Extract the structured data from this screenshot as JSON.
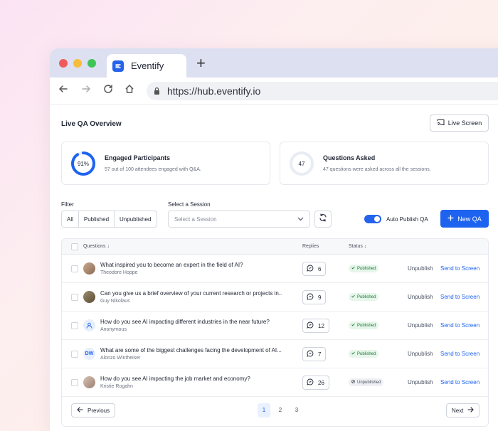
{
  "browser": {
    "tab_title": "Eventify",
    "new_tab": "+",
    "url": "https://hub.eventify.io"
  },
  "page": {
    "title": "Live QA Overview",
    "live_screen_label": "Live Screen"
  },
  "stats": [
    {
      "percent_label": "91%",
      "progress": 0.91,
      "title": "Engaged Participants",
      "subtitle": "57 out of 100 attendees engaged with Q&A."
    },
    {
      "percent_label": "47",
      "progress": 0.0,
      "title": "Questions Asked",
      "subtitle": "47 questions were asked across all the sessions."
    }
  ],
  "filters": {
    "filter_label": "Filter",
    "options": [
      "All",
      "Published",
      "Unpublished"
    ],
    "session_label": "Select a Session",
    "session_placeholder": "Select a Session",
    "auto_publish_label": "Auto Publish QA",
    "auto_publish_on": true,
    "new_qa_label": "New QA"
  },
  "table": {
    "headers": {
      "questions": "Questions",
      "replies": "Replies",
      "status": "Status"
    },
    "rows": [
      {
        "question": "What inspired you to become an expert in the field of AI?",
        "author": "Theodore Hoppe",
        "avatar": "photo",
        "replies": "6",
        "status": "Published",
        "unpublish": "Unpublish",
        "send": "Send to Screen"
      },
      {
        "question": "Can you give us a brief overview of your current research or projects in...",
        "author": "Guy Nikolaus",
        "avatar": "photo",
        "replies": "9",
        "status": "Published",
        "unpublish": "Unpublish",
        "send": "Send to Screen"
      },
      {
        "question": "How do you see AI impacting different industries in the near future?",
        "author": "Anonymous",
        "avatar": "user-icon",
        "replies": "12",
        "status": "Published",
        "unpublish": "Unpublish",
        "send": "Send to Screen"
      },
      {
        "question": "What are some of the biggest challenges facing the development of AI...",
        "author": "Alonzo Wintheiser",
        "avatar": "DW",
        "replies": "7",
        "status": "Published",
        "unpublish": "Unpublish",
        "send": "Send to Screen"
      },
      {
        "question": "How do you see AI impacting the job market and economy?",
        "author": "Kristie Rogahn",
        "avatar": "photo",
        "replies": "26",
        "status": "Unpublished",
        "unpublish": "Unpublish",
        "send": "Send to Screen"
      }
    ]
  },
  "pagination": {
    "previous": "Previous",
    "next": "Next",
    "pages": [
      "1",
      "2",
      "3"
    ],
    "active": "1"
  },
  "colors": {
    "accent": "#1e63f0",
    "published_bg": "#e6f6ea",
    "published_text": "#1f7a3a"
  }
}
